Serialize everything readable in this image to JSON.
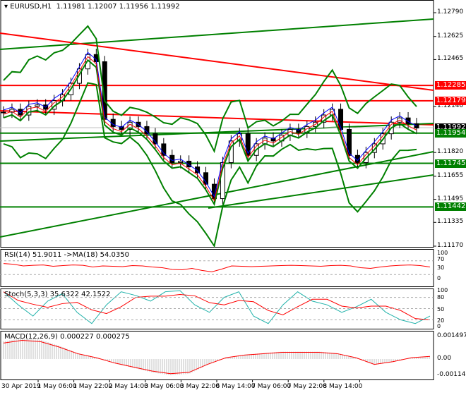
{
  "header": {
    "symbol": "EURUSD,H1",
    "open": "1.11981",
    "high": "1.12007",
    "low": "1.11956",
    "close": "1.11992"
  },
  "price_axis": {
    "ticks": [
      "1.12790",
      "1.12625",
      "1.12465",
      "1.12140",
      "1.11820",
      "1.11655",
      "1.11495",
      "1.11335",
      "1.11170"
    ],
    "tags": [
      {
        "label": "1.12285",
        "color": "#ff0000"
      },
      {
        "label": "1.12179",
        "color": "#ff0000"
      },
      {
        "label": "1.11992",
        "color": "#000000"
      },
      {
        "label": "1.11954",
        "color": "#008000"
      },
      {
        "label": "1.11745",
        "color": "#008000"
      },
      {
        "label": "1.11442",
        "color": "#008000"
      }
    ]
  },
  "levels": {
    "red": [
      1.12285,
      1.12179
    ],
    "green": [
      1.11954,
      1.11745,
      1.11442
    ],
    "current": 1.11992
  },
  "rsi": {
    "label": "RSI(14) 51.9011  ->MA(18) 54.0350",
    "levels": [
      "100",
      "70",
      "30",
      "0"
    ],
    "values": [
      62,
      60,
      55,
      57,
      58,
      54,
      56,
      58,
      57,
      52,
      55,
      54,
      53,
      56,
      55,
      52,
      50,
      45,
      44,
      48,
      42,
      38,
      46,
      55,
      54,
      53,
      54,
      55,
      56,
      57,
      56,
      55,
      54,
      56,
      57,
      55,
      50,
      48,
      52,
      55,
      57,
      58,
      56,
      52
    ]
  },
  "stoch": {
    "label": "Stoch(5,3,3) 35.6322 42.1522",
    "levels": [
      "100",
      "80",
      "50",
      "20",
      "0"
    ],
    "values": [
      95,
      60,
      30,
      70,
      90,
      40,
      10,
      60,
      95,
      85,
      70,
      95,
      98,
      60,
      40,
      80,
      95,
      30,
      10,
      60,
      95,
      70,
      60,
      40,
      55,
      75,
      40,
      20,
      10,
      30
    ]
  },
  "macd": {
    "label": "MACD(12,26,9) 0.000227 0.000275",
    "levels": [
      "0.001497",
      "0.00",
      "-0.001148"
    ],
    "values": [
      0.0012,
      0.0014,
      0.0013,
      0.0009,
      0.0004,
      0.0001,
      -0.0003,
      -0.0006,
      -0.0009,
      -0.0011,
      -0.001,
      -0.0004,
      0.0001,
      0.0003,
      0.0004,
      0.0005,
      0.0005,
      0.0005,
      0.0004,
      0.0001,
      -0.0004,
      -0.0002,
      0.0001,
      0.0002
    ]
  },
  "time_axis": [
    "30 Apr 2019",
    "1 May 06:00",
    "1 May 22:00",
    "2 May 14:00",
    "3 May 06:00",
    "3 May 22:00",
    "6 May 14:00",
    "7 May 06:00",
    "7 May 22:00",
    "8 May 14:00"
  ],
  "chart_data": {
    "type": "candlestick",
    "closes": [
      1.121,
      1.1212,
      1.1208,
      1.1214,
      1.1215,
      1.1212,
      1.1218,
      1.1222,
      1.123,
      1.124,
      1.125,
      1.1245,
      1.1205,
      1.12,
      1.1198,
      1.1203,
      1.12,
      1.1195,
      1.1188,
      1.118,
      1.1175,
      1.1176,
      1.1172,
      1.1168,
      1.116,
      1.115,
      1.1175,
      1.119,
      1.1195,
      1.118,
      1.1188,
      1.1192,
      1.119,
      1.1194,
      1.1198,
      1.1196,
      1.12,
      1.1203,
      1.1208,
      1.1212,
      1.1198,
      1.118,
      1.1175,
      1.1182,
      1.1188,
      1.1195,
      1.1203,
      1.1206,
      1.1202,
      1.1199
    ],
    "ylim": [
      1.1117,
      1.1279
    ]
  }
}
